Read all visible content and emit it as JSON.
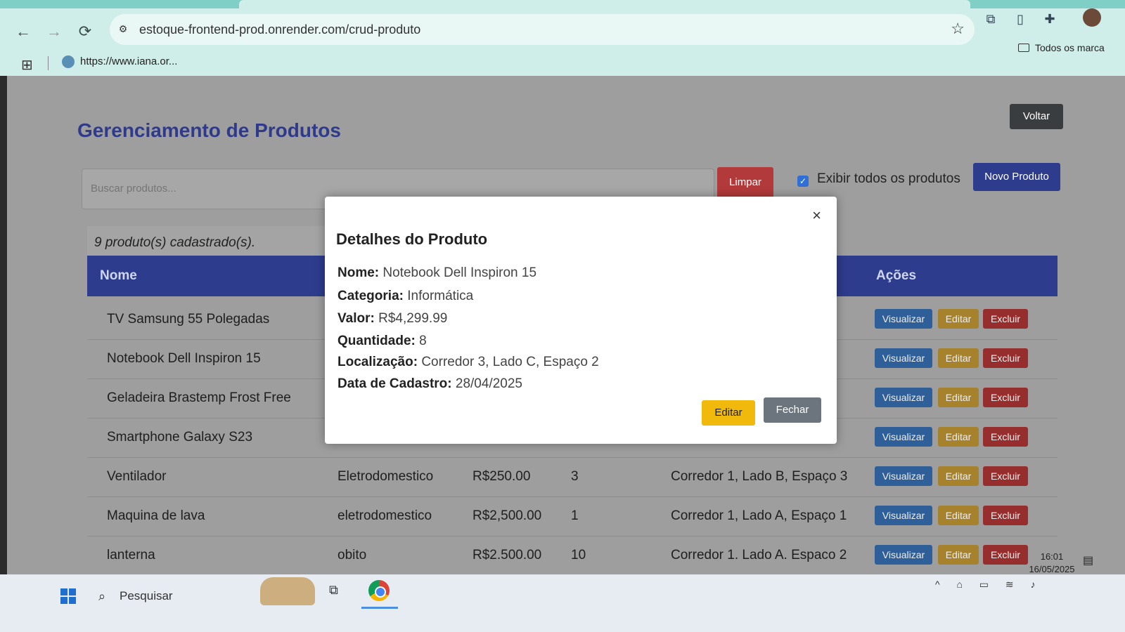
{
  "browser": {
    "url": "estoque-frontend-prod.onrender.com/crud-produto",
    "bookmark": "https://www.iana.or...",
    "all_bookmarks": "Todos os marca"
  },
  "page": {
    "title": "Gerenciamento de Produtos",
    "back_button": "Voltar",
    "search_placeholder": "Buscar produtos...",
    "clear_button": "Limpar",
    "show_all_label": "Exibir todos os produtos",
    "show_all_checked": true,
    "new_button": "Novo Produto",
    "count_text": "9 produto(s) cadastrado(s).",
    "columns": {
      "name": "Nome",
      "actions": "Ações"
    },
    "action_labels": {
      "view": "Visualizar",
      "edit": "Editar",
      "delete": "Excluir"
    },
    "rows": [
      {
        "name": "TV Samsung 55 Polegadas",
        "category": "",
        "value": "",
        "qty": "",
        "location": ""
      },
      {
        "name": "Notebook Dell Inspiron 15",
        "category": "",
        "value": "",
        "qty": "",
        "location": ""
      },
      {
        "name": "Geladeira Brastemp Frost Free",
        "category": "",
        "value": "",
        "qty": "",
        "location": ""
      },
      {
        "name": "Smartphone Galaxy S23",
        "category": "",
        "value": "",
        "qty": "",
        "location": ""
      },
      {
        "name": "Ventilador",
        "category": "Eletrodomestico",
        "value": "R$250.00",
        "qty": "3",
        "location": "Corredor 1, Lado B, Espaço 3"
      },
      {
        "name": "Maquina de lava",
        "category": "eletrodomestico",
        "value": "R$2,500.00",
        "qty": "1",
        "location": "Corredor 1, Lado A, Espaço 1"
      },
      {
        "name": "lanterna",
        "category": "obito",
        "value": "R$2.500.00",
        "qty": "10",
        "location": "Corredor 1. Lado A. Espaco 2"
      }
    ]
  },
  "modal": {
    "title": "Detalhes do Produto",
    "close_icon": "×",
    "fields": {
      "nome_label": "Nome:",
      "nome": "Notebook Dell Inspiron 15",
      "categoria_label": "Categoria:",
      "categoria": "Informática",
      "valor_label": "Valor:",
      "valor": "R$4,299.99",
      "quantidade_label": "Quantidade:",
      "quantidade": "8",
      "localizacao_label": "Localização:",
      "localizacao": "Corredor 3, Lado C, Espaço 2",
      "data_label": "Data de Cadastro:",
      "data": "28/04/2025"
    },
    "edit_button": "Editar",
    "close_button": "Fechar"
  },
  "taskbar": {
    "search_text": "Pesquisar",
    "time": "16:01",
    "date": "16/05/2025"
  },
  "colors": {
    "primary": "#2d3c8c",
    "danger": "#b33a3a",
    "warning": "#f0b90b",
    "secondary": "#6c757d"
  }
}
